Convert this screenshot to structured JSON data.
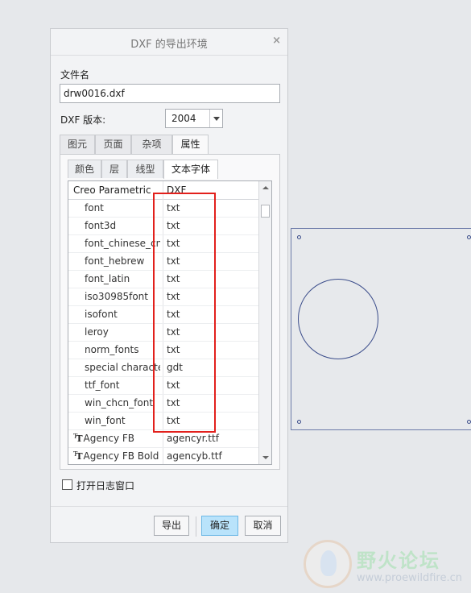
{
  "dialog": {
    "title": "DXF 的导出环境",
    "close_glyph": "×",
    "filename_label": "文件名",
    "filename_value": "drw0016.dxf",
    "version_label": "DXF 版本:",
    "version_value": "2004",
    "tabs": [
      "图元",
      "页面",
      "杂项",
      "属性"
    ],
    "subtabs": [
      "颜色",
      "层",
      "线型",
      "文本字体"
    ],
    "table": {
      "col1_header": "Creo Parametric",
      "col2_header": "DXF",
      "rows": [
        {
          "font": "font",
          "dxf": "txt"
        },
        {
          "font": "font3d",
          "dxf": "txt"
        },
        {
          "font": "font_chinese_cn",
          "dxf": "txt"
        },
        {
          "font": "font_hebrew",
          "dxf": "txt"
        },
        {
          "font": "font_latin",
          "dxf": "txt"
        },
        {
          "font": "iso30985font",
          "dxf": "txt"
        },
        {
          "font": "isofont",
          "dxf": "txt"
        },
        {
          "font": "leroy",
          "dxf": "txt"
        },
        {
          "font": "norm_fonts",
          "dxf": "txt"
        },
        {
          "font": "special characters",
          "dxf": "gdt"
        },
        {
          "font": "ttf_font",
          "dxf": "txt"
        },
        {
          "font": "win_chcn_font",
          "dxf": "txt"
        },
        {
          "font": "win_font",
          "dxf": "txt"
        },
        {
          "font": "Agency FB",
          "dxf": "agencyr.ttf"
        },
        {
          "font": "Agency FB Bold",
          "dxf": "agencyb.ttf"
        }
      ]
    },
    "log_checkbox_label": "打开日志窗口",
    "buttons": {
      "export": "导出",
      "ok": "确定",
      "cancel": "取消"
    }
  },
  "watermark": {
    "title": "野火论坛",
    "url": "www.proewildfire.cn"
  },
  "colors": {
    "highlight_box": "#e2201c",
    "ok_button": "#b9e3fb",
    "drawing_line": "#3a4c8a"
  },
  "icons": {
    "truetype_font": "truetype-font-icon",
    "dropdown": "chevron-down-icon",
    "scroll_up": "scroll-up-icon",
    "scroll_down": "scroll-down-icon"
  }
}
